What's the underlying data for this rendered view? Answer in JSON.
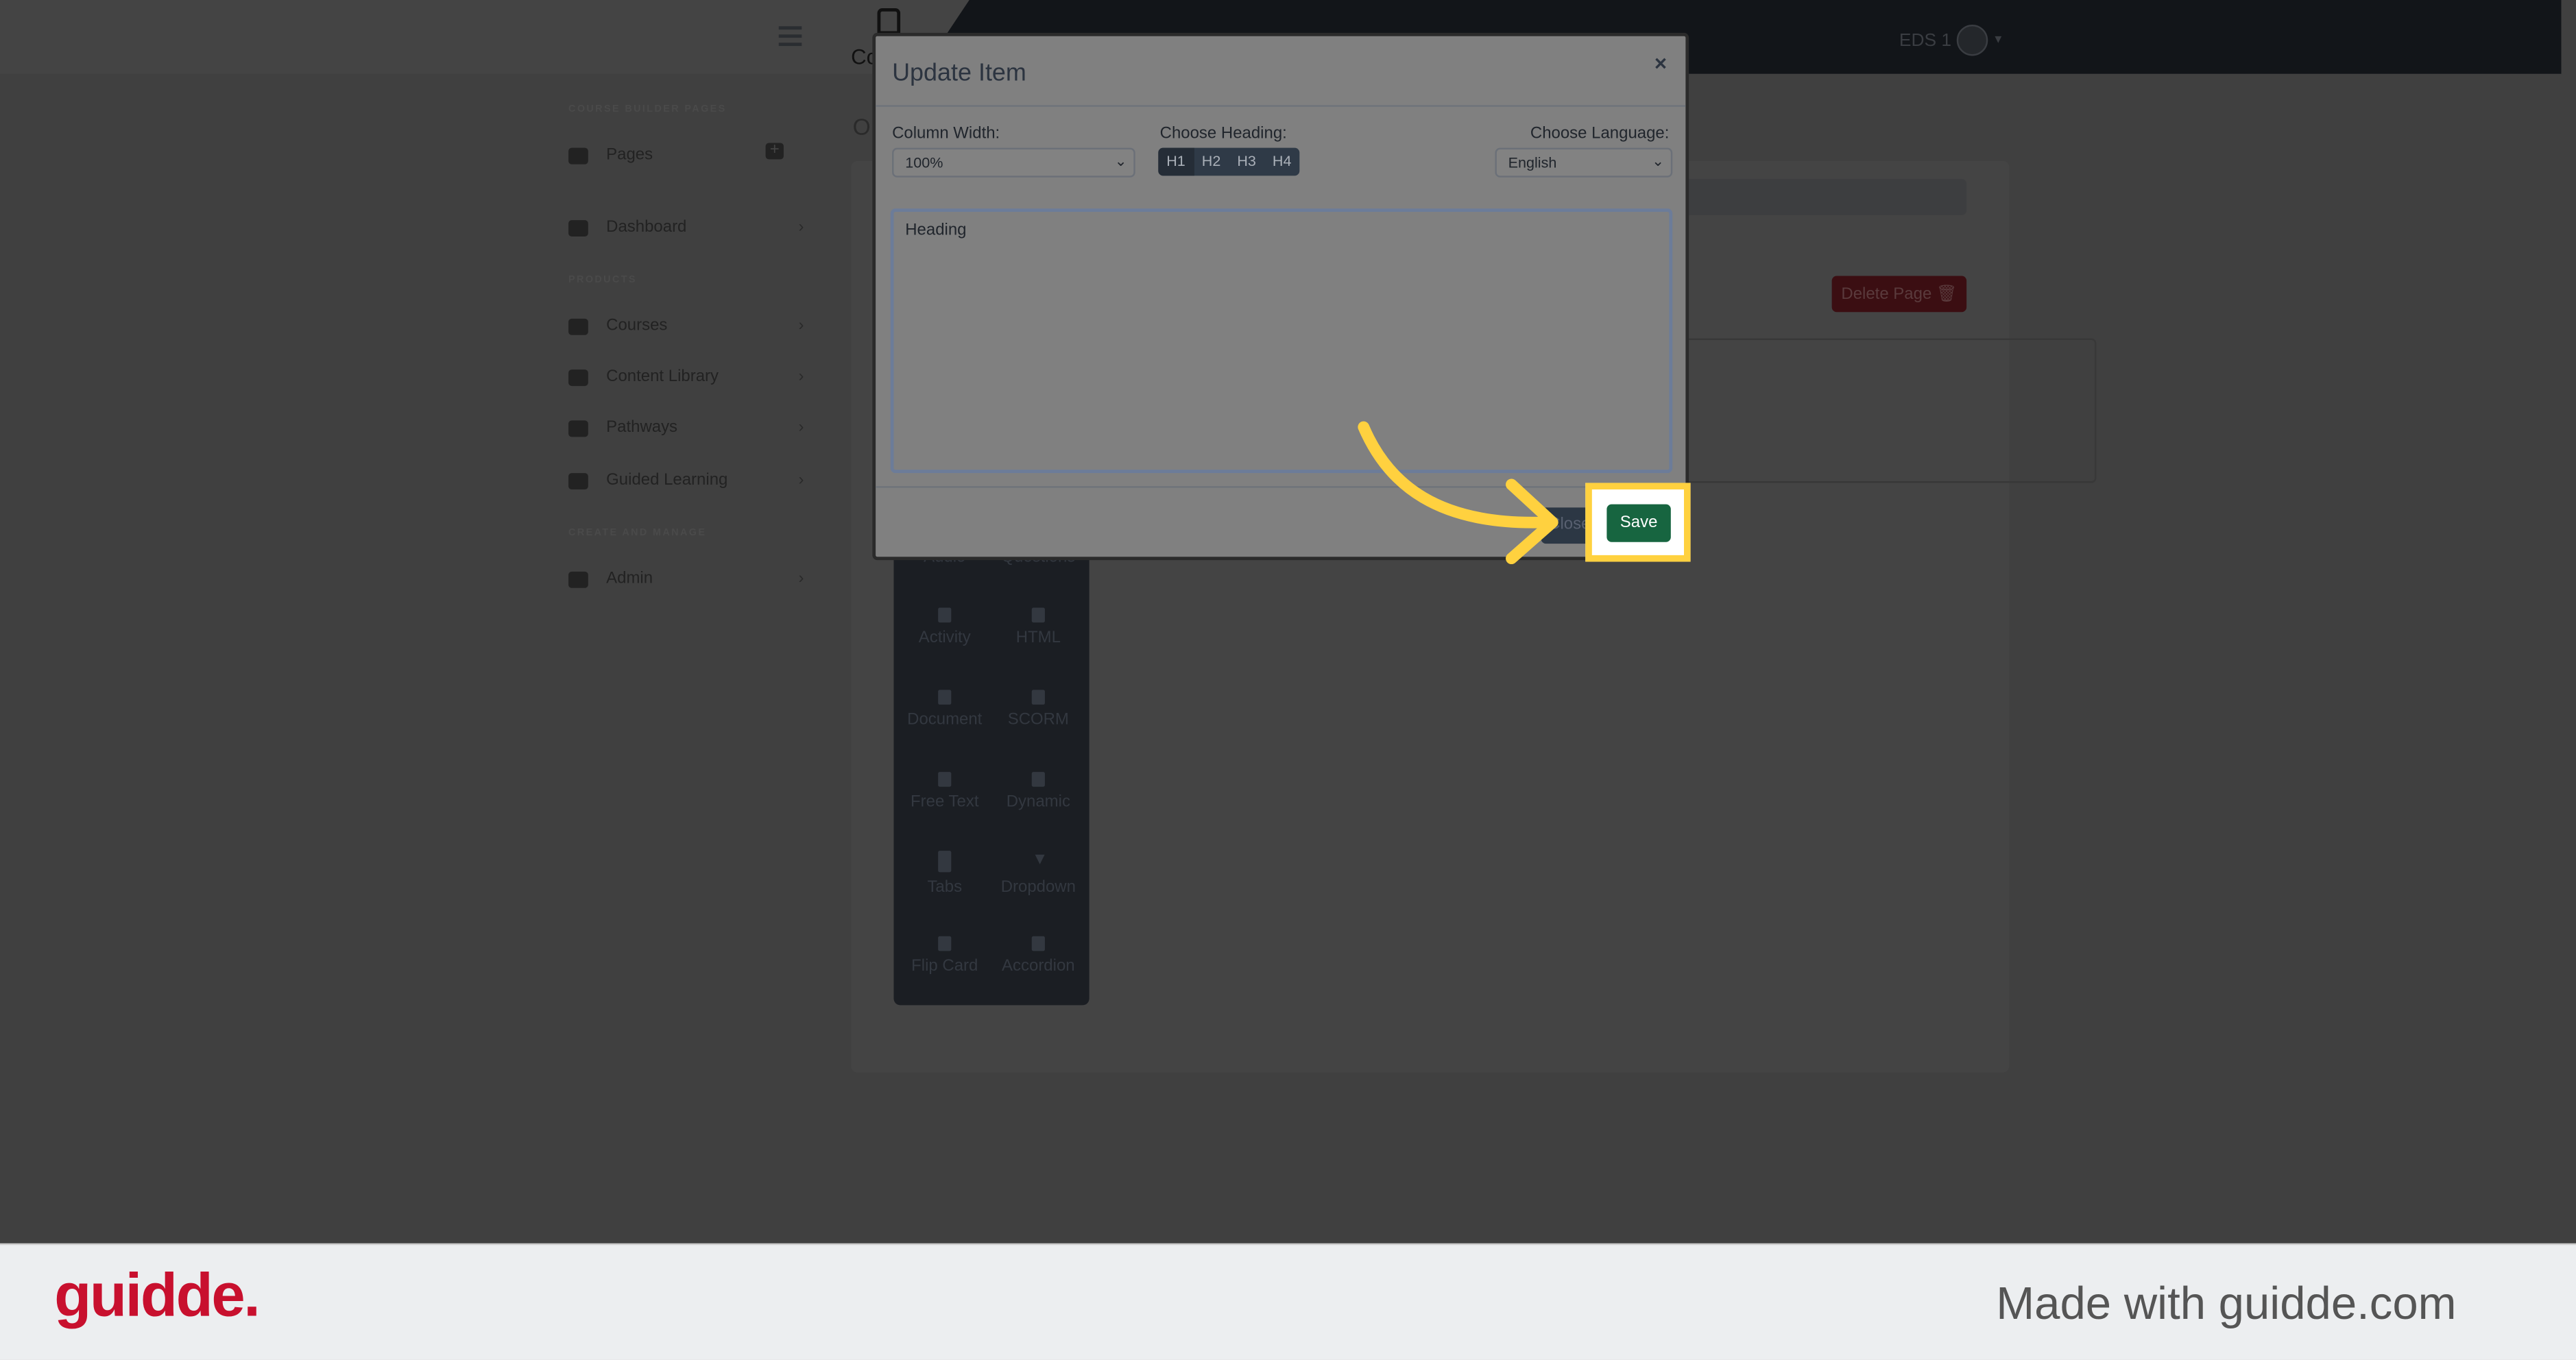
{
  "header": {
    "brand_partial": "Co",
    "user_name": "EDS 1"
  },
  "sidebar": {
    "section_pages": "COURSE BUILDER PAGES",
    "pages_label": "Pages",
    "section_products": "PRODUCTS",
    "section_manage": "CREATE AND MANAGE",
    "items": [
      {
        "label": "Dashboard",
        "icon": "dashboard-icon"
      },
      {
        "label": "Courses",
        "icon": "courses-icon"
      },
      {
        "label": "Content Library",
        "icon": "book-icon"
      },
      {
        "label": "Pathways",
        "icon": "award-icon"
      },
      {
        "label": "Guided Learning",
        "icon": "clipboard-icon"
      },
      {
        "label": "Admin",
        "icon": "gear-icon"
      }
    ]
  },
  "page": {
    "delete_page": "Delete Page",
    "heading_partial": "O"
  },
  "tools": [
    "Audio",
    "Questions",
    "Activity",
    "HTML",
    "Document",
    "SCORM",
    "Free Text",
    "Dynamic",
    "Tabs",
    "Dropdown",
    "Flip Card",
    "Accordion"
  ],
  "modal": {
    "title": "Update Item",
    "close_x": "×",
    "column_width_label": "Column Width:",
    "column_width_value": "100%",
    "heading_label": "Choose Heading:",
    "headings": [
      "H1",
      "H2",
      "H3",
      "H4"
    ],
    "heading_selected": "H1",
    "language_label": "Choose Language:",
    "language_value": "English",
    "textarea_value": "Heading",
    "close_button": "Close",
    "save_button": "Save"
  },
  "footer": {
    "logo": "guidde.",
    "made_with": "Made with guidde.com"
  },
  "colors": {
    "save": "#176540",
    "highlight": "#ffd13f",
    "logo": "#c8102e"
  }
}
